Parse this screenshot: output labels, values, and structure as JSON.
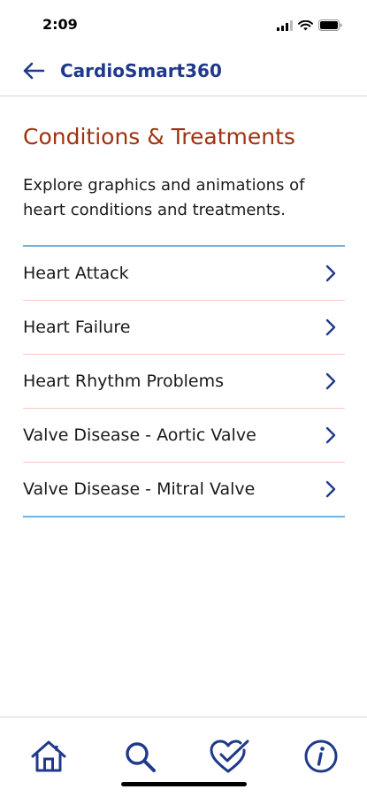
{
  "status_bar": {
    "time": "2:09"
  },
  "nav": {
    "title": "CardioSmart360",
    "back_icon": "arrow-left-icon"
  },
  "page": {
    "title": "Conditions & Treatments",
    "description": "Explore graphics and animations of heart conditions and treatments."
  },
  "list": {
    "items": [
      {
        "label": "Heart Attack"
      },
      {
        "label": "Heart Failure"
      },
      {
        "label": "Heart Rhythm Problems"
      },
      {
        "label": "Valve Disease - Aortic Valve"
      },
      {
        "label": "Valve Disease - Mitral Valve"
      }
    ]
  },
  "tab_bar": {
    "tabs": [
      {
        "icon": "home-icon"
      },
      {
        "icon": "search-icon"
      },
      {
        "icon": "heart-check-icon"
      },
      {
        "icon": "info-icon"
      }
    ]
  },
  "colors": {
    "brand_blue": "#1f3a8a",
    "title_red": "#a03212",
    "divider_blue": "#6fb2e6",
    "divider_salmon": "#f2cbbf"
  }
}
